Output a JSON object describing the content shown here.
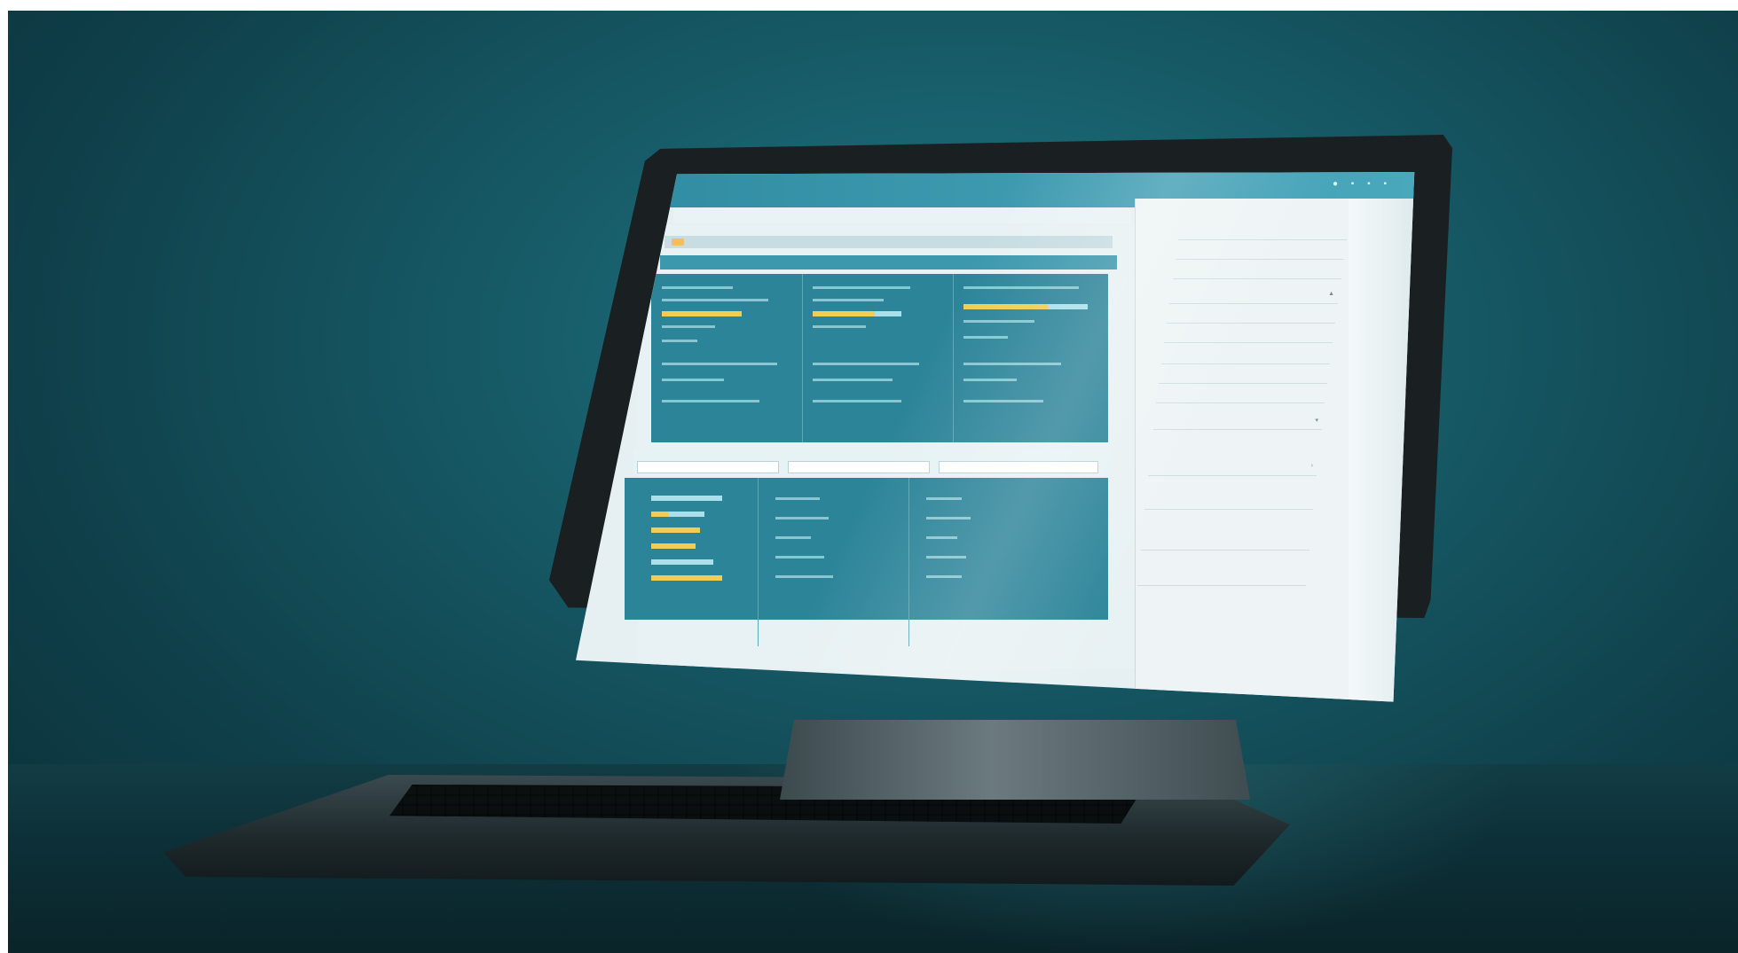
{
  "window": {
    "title": "",
    "toolbar_icons": "● ▪ ▪ ▪"
  },
  "subbar": {
    "text": ""
  },
  "tealbar": {
    "left": "",
    "mid": "",
    "right": ""
  },
  "side_panel": {
    "header": "",
    "rows": [
      "",
      "",
      "",
      "",
      "",
      "",
      "",
      "",
      "",
      "",
      "",
      "",
      "",
      ""
    ]
  },
  "colors": {
    "teal_dark": "#2c8499",
    "teal_header": "#3c98ad",
    "accent_yellow": "#f2cc55",
    "accent_cyan": "#a9e0ea",
    "background": "#165a66"
  }
}
